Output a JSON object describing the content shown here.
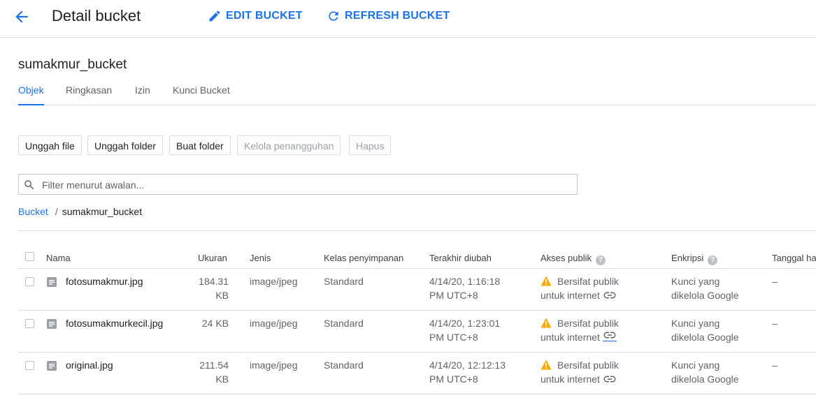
{
  "header": {
    "title": "Detail bucket",
    "edit_label": "EDIT BUCKET",
    "refresh_label": "REFRESH BUCKET"
  },
  "bucket_name": "sumakmur_bucket",
  "tabs": [
    {
      "label": "Objek",
      "active": true
    },
    {
      "label": "Ringkasan",
      "active": false
    },
    {
      "label": "Izin",
      "active": false
    },
    {
      "label": "Kunci Bucket",
      "active": false
    }
  ],
  "toolbar": {
    "upload_file": "Unggah file",
    "upload_folder": "Unggah folder",
    "create_folder": "Buat folder",
    "manage_holds": "Kelola penangguhan",
    "delete": "Hapus"
  },
  "filter": {
    "placeholder": "Filter menurut awalan..."
  },
  "breadcrumb": {
    "root": "Bucket",
    "separator": "/",
    "current": "sumakmur_bucket"
  },
  "table": {
    "headers": {
      "name": "Nama",
      "size": "Ukuran",
      "type": "Jenis",
      "storage_class": "Kelas penyimpanan",
      "last_modified": "Terakhir diubah",
      "public_access": "Akses publik",
      "encryption": "Enkripsi",
      "date": "Tanggal ha"
    },
    "rows": [
      {
        "name": "fotosumakmur.jpg",
        "size_line1": "184.31",
        "size_line2": "KB",
        "type": "image/jpeg",
        "storage": "Standard",
        "modified_line1": "4/14/20, 1:16:18",
        "modified_line2": "PM UTC+8",
        "access_line1": "Bersifat publik",
        "access_line2": "untuk internet",
        "enc_line1": "Kunci yang",
        "enc_line2": "dikelola Google",
        "date": "–"
      },
      {
        "name": "fotosumakmurkecil.jpg",
        "size_line1": "24 KB",
        "size_line2": "",
        "type": "image/jpeg",
        "storage": "Standard",
        "modified_line1": "4/14/20, 1:23:01",
        "modified_line2": "PM UTC+8",
        "access_line1": "Bersifat publik",
        "access_line2": "untuk internet",
        "enc_line1": "Kunci yang",
        "enc_line2": "dikelola Google",
        "date": "–"
      },
      {
        "name": "original.jpg",
        "size_line1": "211.54",
        "size_line2": "KB",
        "type": "image/jpeg",
        "storage": "Standard",
        "modified_line1": "4/14/20, 12:12:13",
        "modified_line2": "PM UTC+8",
        "access_line1": "Bersifat publik",
        "access_line2": "untuk internet",
        "enc_line1": "Kunci yang",
        "enc_line2": "dikelola Google",
        "date": "–"
      }
    ]
  },
  "colors": {
    "accent": "#1a73e8",
    "warning": "#f9ab00",
    "border": "#dadce0"
  },
  "icons": {
    "back": "arrow-back-icon",
    "edit": "pencil-icon",
    "refresh": "refresh-icon",
    "search": "search-icon",
    "help": "help-icon",
    "file": "file-icon",
    "warning": "warning-icon",
    "link": "link-icon"
  }
}
